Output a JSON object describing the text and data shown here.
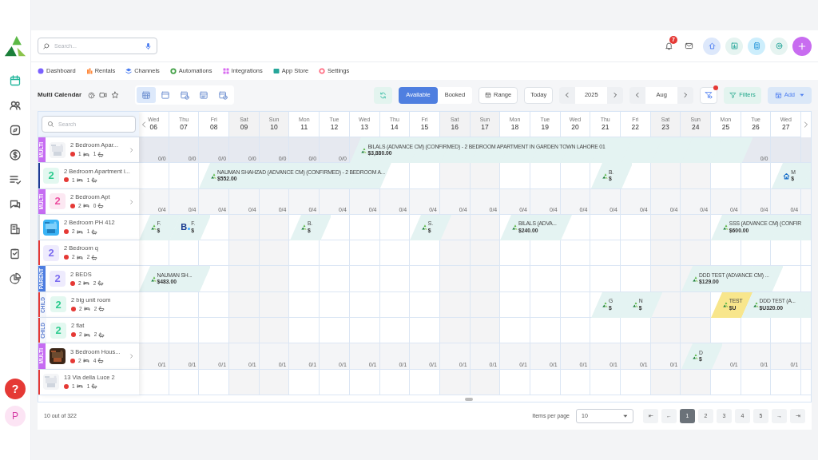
{
  "sidebar": {
    "items": [
      {
        "kind": "calendar",
        "selected": true
      },
      {
        "kind": "people",
        "selected": false
      },
      {
        "kind": "compass",
        "selected": false
      },
      {
        "kind": "dollar",
        "selected": false
      },
      {
        "kind": "checklist",
        "selected": false
      },
      {
        "kind": "chat",
        "selected": false
      },
      {
        "kind": "building",
        "selected": false
      },
      {
        "kind": "clipboard",
        "selected": false
      },
      {
        "kind": "pie",
        "selected": false
      }
    ],
    "help": "?",
    "avatar": "P"
  },
  "search": {
    "placeholder": "Search..."
  },
  "notifications": {
    "count": "7"
  },
  "nav": [
    {
      "label": "Dashboard",
      "color": "#7b61ff"
    },
    {
      "label": "Rentals",
      "color": "#ff8a3d"
    },
    {
      "label": "Channels",
      "color": "#4a7cf0"
    },
    {
      "label": "Automations",
      "color": "#43a047"
    },
    {
      "label": "Integrations",
      "color": "#d86bf0"
    },
    {
      "label": "App Store",
      "color": "#26a69a"
    },
    {
      "label": "Settings",
      "color": "#ff6b81"
    }
  ],
  "toolbar": {
    "title": "Multi Calendar",
    "views": [
      {
        "selected": true
      },
      {
        "selected": false
      },
      {
        "selected": false
      },
      {
        "selected": false
      },
      {
        "selected": false
      }
    ],
    "modes": [
      {
        "label": "Available",
        "selected": true
      },
      {
        "label": "Booked",
        "selected": false
      }
    ],
    "range": "Range",
    "today": "Today",
    "year": "2025",
    "month": "Aug",
    "filter_alert": true,
    "filters": "Filters",
    "add": "Add"
  },
  "calendar": {
    "search_placeholder": "Search",
    "days": [
      {
        "weekday": "Wed",
        "day": "06",
        "weekend": false
      },
      {
        "weekday": "Thu",
        "day": "07",
        "weekend": false
      },
      {
        "weekday": "Fri",
        "day": "08",
        "weekend": false
      },
      {
        "weekday": "Sat",
        "day": "09",
        "weekend": true
      },
      {
        "weekday": "Sun",
        "day": "10",
        "weekend": true
      },
      {
        "weekday": "Mon",
        "day": "11",
        "weekend": false
      },
      {
        "weekday": "Tue",
        "day": "12",
        "weekend": false
      },
      {
        "weekday": "Wed",
        "day": "13",
        "weekend": false
      },
      {
        "weekday": "Thu",
        "day": "14",
        "weekend": false
      },
      {
        "weekday": "Fri",
        "day": "15",
        "weekend": false
      },
      {
        "weekday": "Sat",
        "day": "16",
        "weekend": true
      },
      {
        "weekday": "Sun",
        "day": "17",
        "weekend": true
      },
      {
        "weekday": "Mon",
        "day": "18",
        "weekend": false
      },
      {
        "weekday": "Tue",
        "day": "19",
        "weekend": false
      },
      {
        "weekday": "Wed",
        "day": "20",
        "weekend": false
      },
      {
        "weekday": "Thu",
        "day": "21",
        "weekend": false
      },
      {
        "weekday": "Fri",
        "day": "22",
        "weekend": false
      },
      {
        "weekday": "Sat",
        "day": "23",
        "weekend": true
      },
      {
        "weekday": "Sun",
        "day": "24",
        "weekend": true
      },
      {
        "weekday": "Mon",
        "day": "25",
        "weekend": false
      },
      {
        "weekday": "Tue",
        "day": "26",
        "weekend": false
      },
      {
        "weekday": "Wed",
        "day": "27",
        "weekend": false
      }
    ],
    "rows": [
      {
        "name": "2 Bedroom Apar...",
        "tag": {
          "kind": "filled",
          "label": "MULTI",
          "color": "#c66cf2"
        },
        "thumb": {
          "kind": "picture"
        },
        "status_dot": {
          "color": "#e53935"
        },
        "beds": "1",
        "baths": "1",
        "expandable": true,
        "color": "#e6e9f0",
        "cells": [
          {
            "occupied": false,
            "availability": "0/0"
          },
          {
            "occupied": false,
            "availability": "0/0"
          },
          {
            "occupied": false,
            "availability": "0/0"
          },
          {
            "occupied": false,
            "availability": "0/0"
          },
          {
            "occupied": false,
            "availability": "0/0"
          },
          {
            "occupied": false,
            "availability": "0/0"
          },
          {
            "occupied": false,
            "availability": "0/0"
          },
          {
            "occupied": true,
            "booking": {
              "kind": "app",
              "title": "BILALS (ADVANCE CM) (CONFIRMED) - 2 BEDROOM APARTMENT IN GARDEN TOWN LAHORE 01",
              "price": "$3,880.00",
              "color": "#e4f3f2"
            }
          },
          {
            "occupied": true
          },
          {
            "occupied": true
          },
          {
            "occupied": true
          },
          {
            "occupied": true
          },
          {
            "occupied": true
          },
          {
            "occupied": true
          },
          {
            "occupied": true
          },
          {
            "occupied": true
          },
          {
            "occupied": true
          },
          {
            "occupied": true
          },
          {
            "occupied": true
          },
          {
            "occupied": true
          },
          {
            "occupied": false,
            "availability": "0/0"
          }
        ]
      },
      {
        "name": "2 Bedroom Apartment i...",
        "tag": {
          "kind": "line",
          "color": "#1f3a93"
        },
        "thumb": {
          "kind": "number",
          "text": "2",
          "color": "#2ecc8f"
        },
        "status_dot": {
          "color": "#e53935"
        },
        "beds": "1",
        "baths": "1",
        "expandable": false,
        "cells": [
          {
            "occupied": false
          },
          {
            "occupied": false
          },
          {
            "occupied": true,
            "booking": {
              "kind": "app",
              "title": "NAUMAN SHAHZAD (ADVANCE CM) (CONFIRMED) - 2 BEDROOM A...",
              "price": "$552.00",
              "color": "#e4f3f2"
            }
          },
          {
            "occupied": true
          },
          {
            "occupied": true
          },
          {
            "occupied": true
          },
          {
            "occupied": true
          },
          {
            "occupied": true
          },
          {
            "occupied": false
          },
          {
            "occupied": false
          },
          {
            "occupied": false
          },
          {
            "occupied": false
          },
          {
            "occupied": false
          },
          {
            "occupied": false
          },
          {
            "occupied": false
          },
          {
            "occupied": true,
            "booking": {
              "kind": "app",
              "title": "B.",
              "price": "$",
              "color": "#e4f3f2"
            }
          },
          {
            "occupied": false
          },
          {
            "occupied": false
          },
          {
            "occupied": false
          },
          {
            "occupied": false
          },
          {
            "occupied": false
          },
          {
            "occupied": true,
            "booking": {
              "kind": "house",
              "title": "M",
              "price": "$",
              "color": "#e4f3f2"
            }
          }
        ]
      },
      {
        "name": "2 Bedroom Apt",
        "tag": {
          "kind": "filled",
          "label": "MULTI",
          "color": "#c66cf2"
        },
        "thumb": {
          "kind": "number",
          "text": "2",
          "color": "#ec4fa0"
        },
        "status_dot": {
          "color": "#e53935"
        },
        "beds": "2",
        "baths": "0",
        "expandable": true,
        "color": "#f4f5f7",
        "cells": [
          {
            "occupied": false,
            "availability": "0/4"
          },
          {
            "occupied": false,
            "availability": "0/4"
          },
          {
            "occupied": false,
            "availability": "0/4"
          },
          {
            "occupied": false,
            "availability": "0/4"
          },
          {
            "occupied": false,
            "availability": "0/4"
          },
          {
            "occupied": false,
            "availability": "0/4"
          },
          {
            "occupied": false,
            "availability": "0/4"
          },
          {
            "occupied": false,
            "availability": "0/4"
          },
          {
            "occupied": false,
            "availability": "0/4"
          },
          {
            "occupied": false,
            "availability": "0/4"
          },
          {
            "occupied": false,
            "availability": "0/4"
          },
          {
            "occupied": false,
            "availability": "0/4"
          },
          {
            "occupied": false,
            "availability": "0/4"
          },
          {
            "occupied": false,
            "availability": "0/4"
          },
          {
            "occupied": false,
            "availability": "0/4"
          },
          {
            "occupied": false,
            "availability": "0/4"
          },
          {
            "occupied": false,
            "availability": "0/4"
          },
          {
            "occupied": false,
            "availability": "0/4"
          },
          {
            "occupied": false,
            "availability": "0/4"
          },
          {
            "occupied": false,
            "availability": "0/4"
          },
          {
            "occupied": false,
            "availability": "0/4"
          },
          {
            "occupied": false,
            "availability": "0/4"
          }
        ]
      },
      {
        "name": "2 Bedroom PH 412",
        "tag": {
          "kind": "line",
          "color": "#d5dbe3"
        },
        "thumb": {
          "kind": "picture"
        },
        "status_dot": {
          "color": "#e53935"
        },
        "beds": "2",
        "baths": "1",
        "expandable": false,
        "cells": [
          {
            "occupied": true,
            "booking": {
              "kind": "app",
              "title": "F.",
              "price": "$",
              "color": "#e4f3f2"
            }
          },
          {
            "occupied": true,
            "booking": {
              "kind": "booking",
              "logo": "B",
              "title": "F.",
              "price": "$",
              "color": "#e4f3f2"
            }
          },
          {
            "occupied": false
          },
          {
            "occupied": false
          },
          {
            "occupied": false
          },
          {
            "occupied": true,
            "booking": {
              "kind": "app",
              "title": "B.",
              "price": "$",
              "color": "#e4f3f2"
            }
          },
          {
            "occupied": false
          },
          {
            "occupied": false
          },
          {
            "occupied": false
          },
          {
            "occupied": true,
            "booking": {
              "kind": "app",
              "title": "S.",
              "price": "$",
              "color": "#e4f3f2"
            }
          },
          {
            "occupied": false
          },
          {
            "occupied": false
          },
          {
            "occupied": true,
            "booking": {
              "kind": "app",
              "title": "BILALS (ADVA...",
              "price": "$240.00",
              "color": "#e4f3f2"
            }
          },
          {
            "occupied": true
          },
          {
            "occupied": false
          },
          {
            "occupied": false
          },
          {
            "occupied": false
          },
          {
            "occupied": false
          },
          {
            "occupied": false
          },
          {
            "occupied": true,
            "booking": {
              "kind": "app",
              "title": "SSS (ADVANCE CM) (CONFIR",
              "price": "$600.00",
              "color": "#e4f3f2"
            }
          },
          {
            "occupied": true
          },
          {
            "occupied": true
          }
        ]
      },
      {
        "name": "2 Bedroom q",
        "tag": {
          "kind": "line",
          "color": "#e53935"
        },
        "thumb": {
          "kind": "number",
          "text": "2",
          "color": "#7c6cf0"
        },
        "status_dot": {
          "color": "#e53935"
        },
        "beds": "2",
        "baths": "2",
        "expandable": false,
        "cells": [
          {
            "occupied": false
          },
          {
            "occupied": false
          },
          {
            "occupied": false
          },
          {
            "occupied": false
          },
          {
            "occupied": false
          },
          {
            "occupied": false
          },
          {
            "occupied": false
          },
          {
            "occupied": false
          },
          {
            "occupied": false
          },
          {
            "occupied": false
          },
          {
            "occupied": false
          },
          {
            "occupied": false
          },
          {
            "occupied": false
          },
          {
            "occupied": false
          },
          {
            "occupied": false
          },
          {
            "occupied": false
          },
          {
            "occupied": false
          },
          {
            "occupied": false
          },
          {
            "occupied": false
          },
          {
            "occupied": false
          },
          {
            "occupied": false
          },
          {
            "occupied": false
          }
        ]
      },
      {
        "name": "2 BEDS",
        "tag": {
          "kind": "filled",
          "label": "PARENT",
          "color": "#4d7de0"
        },
        "thumb": {
          "kind": "number",
          "text": "2",
          "color": "#7c6cf0"
        },
        "status_dot": {
          "color": "#e53935"
        },
        "beds": "2",
        "baths": "2",
        "expandable": false,
        "cells": [
          {
            "occupied": true,
            "booking": {
              "kind": "app",
              "title": "NAUMAN SH...",
              "price": "$483.00",
              "color": "#e4f3f2"
            }
          },
          {
            "occupied": true
          },
          {
            "occupied": false
          },
          {
            "occupied": false
          },
          {
            "occupied": false
          },
          {
            "occupied": false
          },
          {
            "occupied": false
          },
          {
            "occupied": false
          },
          {
            "occupied": false
          },
          {
            "occupied": false
          },
          {
            "occupied": false
          },
          {
            "occupied": false
          },
          {
            "occupied": false
          },
          {
            "occupied": false
          },
          {
            "occupied": false
          },
          {
            "occupied": false
          },
          {
            "occupied": false
          },
          {
            "occupied": false
          },
          {
            "occupied": true,
            "booking": {
              "kind": "app",
              "title": "DDD TEST (ADVANCE CM) ...",
              "price": "$129.00",
              "color": "#e4f3f2"
            }
          },
          {
            "occupied": true
          },
          {
            "occupied": true
          },
          {
            "occupied": false
          }
        ]
      },
      {
        "name": "2 big unit room",
        "tag": {
          "kind": "outline",
          "label": "CHILD",
          "color": "#e53935"
        },
        "thumb": {
          "kind": "number",
          "text": "2",
          "color": "#2ecc8f"
        },
        "status_dot": {
          "color": "#e53935"
        },
        "beds": "2",
        "baths": "2",
        "expandable": false,
        "cells": [
          {
            "occupied": false
          },
          {
            "occupied": false
          },
          {
            "occupied": false
          },
          {
            "occupied": false
          },
          {
            "occupied": false
          },
          {
            "occupied": false
          },
          {
            "occupied": false
          },
          {
            "occupied": false
          },
          {
            "occupied": false
          },
          {
            "occupied": false
          },
          {
            "occupied": false
          },
          {
            "occupied": false
          },
          {
            "occupied": false
          },
          {
            "occupied": false
          },
          {
            "occupied": false
          },
          {
            "occupied": true,
            "booking": {
              "kind": "app",
              "title": "G",
              "price": "$",
              "color": "#e4f3f2"
            }
          },
          {
            "occupied": true,
            "booking": {
              "kind": "app",
              "title": "N",
              "price": "$",
              "color": "#e4f3f2"
            }
          },
          {
            "occupied": false
          },
          {
            "occupied": false
          },
          {
            "occupied": true,
            "booking": {
              "kind": "app",
              "title": "TEST",
              "price": "$U",
              "color": "#f8e68c"
            }
          },
          {
            "occupied": true,
            "booking": {
              "kind": "app",
              "title": "DDD TEST (A...",
              "price": "$U320.00",
              "color": "#e4f3f2"
            }
          },
          {
            "occupied": true
          }
        ]
      },
      {
        "name": "2 flat",
        "tag": {
          "kind": "outline",
          "label": "CHILD",
          "color": "#e53935"
        },
        "thumb": {
          "kind": "number",
          "text": "2",
          "color": "#2ecc8f"
        },
        "status_dot": {
          "color": "#e53935"
        },
        "beds": "2",
        "baths": "2",
        "expandable": false,
        "cells": [
          {
            "occupied": false
          },
          {
            "occupied": false
          },
          {
            "occupied": false
          },
          {
            "occupied": false
          },
          {
            "occupied": false
          },
          {
            "occupied": false
          },
          {
            "occupied": false
          },
          {
            "occupied": false
          },
          {
            "occupied": false
          },
          {
            "occupied": false
          },
          {
            "occupied": false
          },
          {
            "occupied": false
          },
          {
            "occupied": false
          },
          {
            "occupied": false
          },
          {
            "occupied": false
          },
          {
            "occupied": false
          },
          {
            "occupied": false
          },
          {
            "occupied": false
          },
          {
            "occupied": false
          },
          {
            "occupied": false
          },
          {
            "occupied": false
          },
          {
            "occupied": false
          }
        ]
      },
      {
        "name": "3 Bedroom Hous...",
        "tag": {
          "kind": "filled",
          "label": "MULTI",
          "color": "#c66cf2"
        },
        "thumb": {
          "kind": "picture"
        },
        "status_dot": {
          "color": "#e53935"
        },
        "beds": "2",
        "baths": "4",
        "expandable": true,
        "color": "#f4f5f7",
        "cells": [
          {
            "occupied": false,
            "availability": "0/1"
          },
          {
            "occupied": false,
            "availability": "0/1"
          },
          {
            "occupied": false,
            "availability": "0/1"
          },
          {
            "occupied": false,
            "availability": "0/1"
          },
          {
            "occupied": false,
            "availability": "0/1"
          },
          {
            "occupied": false,
            "availability": "0/1"
          },
          {
            "occupied": false,
            "availability": "0/1"
          },
          {
            "occupied": false,
            "availability": "0/1"
          },
          {
            "occupied": false,
            "availability": "0/1"
          },
          {
            "occupied": false,
            "availability": "0/1"
          },
          {
            "occupied": false,
            "availability": "0/1"
          },
          {
            "occupied": false,
            "availability": "0/1"
          },
          {
            "occupied": false,
            "availability": "0/1"
          },
          {
            "occupied": false,
            "availability": "0/1"
          },
          {
            "occupied": false,
            "availability": "0/1"
          },
          {
            "occupied": false,
            "availability": "0/1"
          },
          {
            "occupied": false,
            "availability": "0/1"
          },
          {
            "occupied": false,
            "availability": "0/1"
          },
          {
            "occupied": true,
            "booking": {
              "kind": "app",
              "title": "D",
              "price": "$",
              "color": "#e4f3f2"
            }
          },
          {
            "occupied": false,
            "availability": "0/1"
          },
          {
            "occupied": false,
            "availability": "0/1"
          },
          {
            "occupied": false,
            "availability": "0/1"
          }
        ]
      },
      {
        "name": "13 Via della Luce 2",
        "tag": {
          "kind": "line",
          "color": "#e53935"
        },
        "thumb": {
          "kind": "picture"
        },
        "status_dot": {
          "color": "#e53935"
        },
        "beds": "1",
        "baths": "1",
        "expandable": false,
        "cells": [
          {
            "occupied": false
          },
          {
            "occupied": false
          },
          {
            "occupied": false
          },
          {
            "occupied": false
          },
          {
            "occupied": false
          },
          {
            "occupied": false
          },
          {
            "occupied": false
          },
          {
            "occupied": false
          },
          {
            "occupied": false
          },
          {
            "occupied": false
          },
          {
            "occupied": false
          },
          {
            "occupied": false
          },
          {
            "occupied": false
          },
          {
            "occupied": false
          },
          {
            "occupied": false
          },
          {
            "occupied": false
          },
          {
            "occupied": false
          },
          {
            "occupied": false
          },
          {
            "occupied": false
          },
          {
            "occupied": false
          },
          {
            "occupied": false
          },
          {
            "occupied": false
          }
        ]
      }
    ]
  },
  "footer": {
    "summary": "10 out of 322",
    "per_page_label": "Items per page",
    "per_page": "10",
    "first": "⇤",
    "prev": "←",
    "next": "→",
    "last": "⇥",
    "pages": [
      {
        "label": "1",
        "selected": true
      },
      {
        "label": "2",
        "selected": false
      },
      {
        "label": "3",
        "selected": false
      },
      {
        "label": "4",
        "selected": false
      },
      {
        "label": "5",
        "selected": false
      }
    ]
  }
}
